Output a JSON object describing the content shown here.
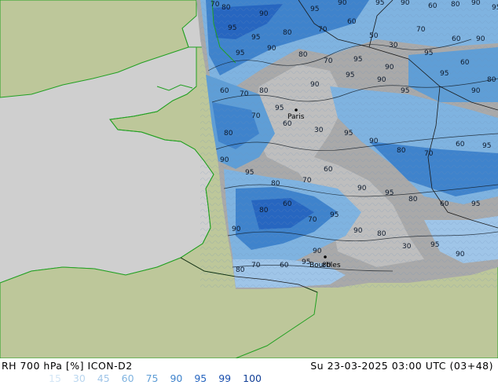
{
  "title": "RH 700 hPa [%] ICON-D2",
  "timestamp": "Su 23-03-2025 03:00 UTC (03+48)",
  "legend": [
    {
      "label": "15",
      "color": "#d3e6f6"
    },
    {
      "label": "30",
      "color": "#b9d6ef"
    },
    {
      "label": "45",
      "color": "#9fc5e8"
    },
    {
      "label": "60",
      "color": "#7fb3e0"
    },
    {
      "label": "75",
      "color": "#5f9ed6"
    },
    {
      "label": "90",
      "color": "#3f83cc"
    },
    {
      "label": "95",
      "color": "#2766c0"
    },
    {
      "label": "99",
      "color": "#1a4fae"
    },
    {
      "label": "100",
      "color": "#123f96"
    }
  ],
  "colors": {
    "land": "#bdc79a",
    "sea": "#cfcfcf",
    "coast": "#22a022",
    "border": "#1a1a1a",
    "contour": "#101820"
  },
  "cities": [
    {
      "name": "Paris"
    },
    {
      "name": "Bourbles"
    }
  ],
  "contour_labels": [
    "70",
    "80",
    "90",
    "95",
    "90",
    "95",
    "90",
    "60",
    "80",
    "90",
    "95",
    "95",
    "95",
    "80",
    "70",
    "60",
    "50",
    "30",
    "70",
    "60",
    "90",
    "95",
    "90",
    "80",
    "70",
    "95",
    "90",
    "95",
    "60",
    "80",
    "60",
    "70",
    "80",
    "95",
    "90",
    "95",
    "90",
    "95",
    "95",
    "90",
    "80",
    "70",
    "60",
    "30",
    "95",
    "90",
    "80",
    "70",
    "60",
    "95",
    "90",
    "95",
    "80",
    "70",
    "60",
    "90",
    "95",
    "80",
    "60",
    "95",
    "90",
    "80",
    "60",
    "70",
    "95",
    "90",
    "80",
    "30",
    "95",
    "90",
    "80",
    "70",
    "60",
    "95",
    "90",
    "80",
    "70",
    "60"
  ]
}
